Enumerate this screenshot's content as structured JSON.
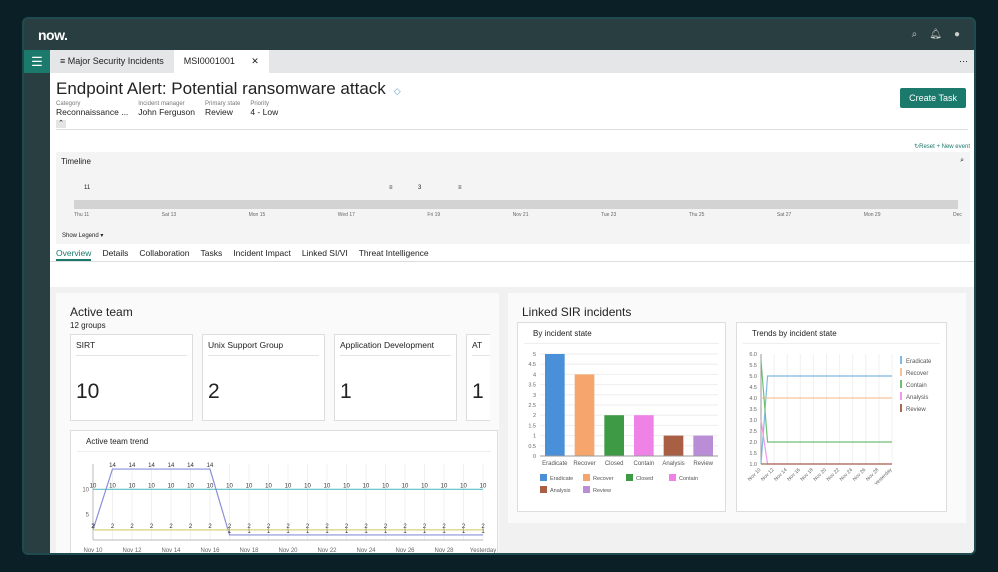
{
  "brand": "now.",
  "nav": {
    "menu_icon": "list-icon",
    "tabs": [
      {
        "label": "≡ Major Security Incidents"
      },
      {
        "label": "MSI0001001",
        "close": "✕"
      }
    ],
    "more": "⋯"
  },
  "record": {
    "title": "Endpoint Alert: Potential ransomware attack",
    "tag": "◇",
    "create_task": "Create Task",
    "fields": [
      {
        "label": "Category",
        "value": "Reconnaissance ..."
      },
      {
        "label": "Incident manager",
        "value": "John Ferguson"
      },
      {
        "label": "Primary state",
        "value": "Review"
      },
      {
        "label": "Priority",
        "value": "4 - Low"
      }
    ]
  },
  "timeline": {
    "title": "Timeline",
    "reset": "↻Reset",
    "new_event": "+ New event",
    "show_legend": "Show Legend ▾",
    "markers": [
      "11",
      "3"
    ],
    "dates": [
      "Thu 11",
      "Sat 13",
      "Mon 15",
      "Wed 17",
      "Fri 19",
      "Nov 21",
      "Tue 23",
      "Thu 25",
      "Sat 27",
      "Mon 29",
      "Dec"
    ]
  },
  "tabs": [
    "Overview",
    "Details",
    "Collaboration",
    "Tasks",
    "Incident Impact",
    "Linked SI/VI",
    "Threat Intelligence"
  ],
  "active_team": {
    "title": "Active team",
    "subtitle": "12 groups",
    "cards": [
      {
        "name": "SIRT",
        "count": "10"
      },
      {
        "name": "Unix Support Group",
        "count": "2"
      },
      {
        "name": "Application Development",
        "count": "1"
      },
      {
        "name": "AT",
        "count": "1"
      }
    ]
  },
  "linked": {
    "title": "Linked SIR incidents"
  },
  "chart_data": [
    {
      "type": "line",
      "title": "Active team trend",
      "x": [
        "Nov 10",
        "Nov 11",
        "Nov 12",
        "Nov 13",
        "Nov 14",
        "Nov 15",
        "Nov 16",
        "Nov 17",
        "Nov 18",
        "Nov 19",
        "Nov 20",
        "Nov 21",
        "Nov 22",
        "Nov 23",
        "Nov 24",
        "Nov 25",
        "Nov 26",
        "Nov 27",
        "Nov 28",
        "Nov 29",
        "Yesterday"
      ],
      "xticks": [
        "Nov 10",
        "Nov 12",
        "Nov 14",
        "Nov 16",
        "Nov 18",
        "Nov 20",
        "Nov 22",
        "Nov 24",
        "Nov 26",
        "Nov 28",
        "Yesterday"
      ],
      "yticks": [
        5,
        10
      ],
      "ylim": [
        0,
        15
      ],
      "series": [
        {
          "color": "#5bc0c8",
          "values": [
            10,
            10,
            10,
            10,
            10,
            10,
            10,
            10,
            10,
            10,
            10,
            10,
            10,
            10,
            10,
            10,
            10,
            10,
            10,
            10,
            10
          ]
        },
        {
          "color": "#8c8fd8",
          "values": [
            2,
            14,
            14,
            14,
            14,
            14,
            14,
            1,
            1,
            1,
            1,
            1,
            1,
            1,
            1,
            1,
            1,
            1,
            1,
            1,
            1
          ]
        },
        {
          "color": "#d8d27a",
          "values": [
            2,
            2,
            2,
            2,
            2,
            2,
            2,
            2,
            2,
            2,
            2,
            2,
            2,
            2,
            2,
            2,
            2,
            2,
            2,
            2,
            2
          ]
        }
      ]
    },
    {
      "type": "bar",
      "title": "By incident state",
      "categories": [
        "Eradicate",
        "Recover",
        "Closed",
        "Contain",
        "Analysis",
        "Review"
      ],
      "values": [
        5,
        4,
        2,
        2,
        1,
        1
      ],
      "colors": [
        "#4a90d9",
        "#f6a66d",
        "#3f9a45",
        "#ee82e6",
        "#a85f44",
        "#b98ed6"
      ],
      "ylim": [
        0,
        5
      ],
      "yticks": [
        "0",
        "0.5",
        "1",
        "1.5",
        "2",
        "2.5",
        "3",
        "3.5",
        "4",
        "4.5",
        "5"
      ],
      "legend": "bottom"
    },
    {
      "type": "line",
      "title": "Trends by incident state",
      "x": [
        "Nov 10",
        "Nov 11",
        "Nov 12",
        "Nov 13",
        "Nov 14",
        "Nov 15",
        "Nov 16",
        "Nov 17",
        "Nov 18",
        "Nov 19",
        "Nov 20",
        "Nov 21",
        "Nov 22",
        "Nov 23",
        "Nov 24",
        "Nov 25",
        "Nov 26",
        "Nov 27",
        "Nov 28",
        "Nov 29",
        "Yesterday"
      ],
      "xticks": [
        "Nov 10",
        "Nov 12",
        "Nov 14",
        "Nov 16",
        "Nov 18",
        "Nov 20",
        "Nov 22",
        "Nov 24",
        "Nov 26",
        "Nov 28",
        "Yesterday"
      ],
      "ylim": [
        1,
        6
      ],
      "yticks": [
        "1.0",
        "1.5",
        "2.0",
        "2.5",
        "3.0",
        "3.5",
        "4.0",
        "4.5",
        "5.0",
        "5.5",
        "6.0"
      ],
      "legend": "right",
      "series": [
        {
          "name": "Eradicate",
          "color": "#7fb8e0",
          "values": [
            1,
            5,
            5,
            5,
            5,
            5,
            5,
            5,
            5,
            5,
            5,
            5,
            5,
            5,
            5,
            5,
            5,
            5,
            5,
            5,
            5
          ]
        },
        {
          "name": "Recover",
          "color": "#f6c39a",
          "values": [
            4,
            4,
            4,
            4,
            4,
            4,
            4,
            4,
            4,
            4,
            4,
            4,
            4,
            4,
            4,
            4,
            4,
            4,
            4,
            4,
            4
          ]
        },
        {
          "name": "Contain",
          "color": "#6fbf73",
          "values": [
            5.7,
            2,
            2,
            2,
            2,
            2,
            2,
            2,
            2,
            2,
            2,
            2,
            2,
            2,
            2,
            2,
            2,
            2,
            2,
            2,
            2
          ]
        },
        {
          "name": "Analysis",
          "color": "#ee9ae6",
          "values": [
            3,
            1,
            1,
            1,
            1,
            1,
            1,
            1,
            1,
            1,
            1,
            1,
            1,
            1,
            1,
            1,
            1,
            1,
            1,
            1,
            1
          ]
        },
        {
          "name": "Review",
          "color": "#a86a50",
          "values": [
            1,
            1,
            1,
            1,
            1,
            1,
            1,
            1,
            1,
            1,
            1,
            1,
            1,
            1,
            1,
            1,
            1,
            1,
            1,
            1,
            1
          ]
        }
      ]
    }
  ]
}
